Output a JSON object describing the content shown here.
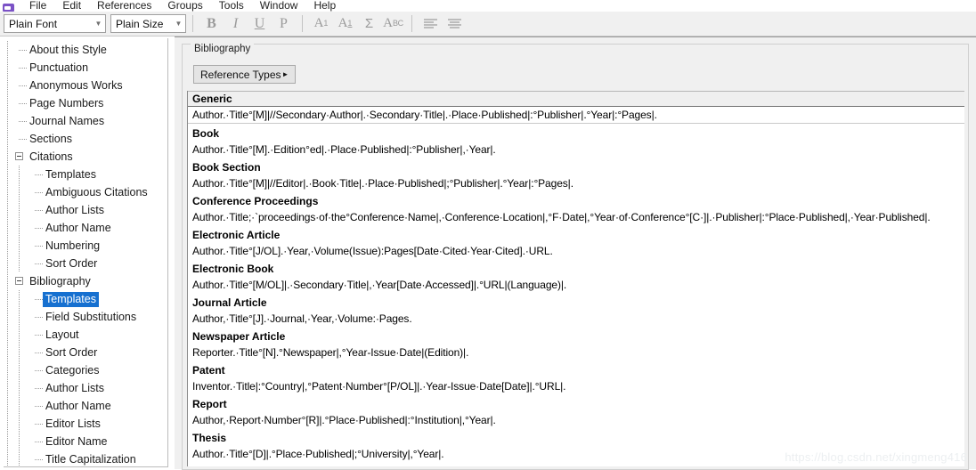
{
  "app": {
    "logo_icon": "endnote-logo-icon",
    "menu": [
      "File",
      "Edit",
      "References",
      "Groups",
      "Tools",
      "Window",
      "Help"
    ]
  },
  "toolbar": {
    "font_combo": {
      "value": "Plain Font",
      "arrow_icon": "chevron-down-icon"
    },
    "size_combo": {
      "value": "Plain Size",
      "arrow_icon": "chevron-down-icon"
    },
    "buttons": [
      {
        "name": "bold-button",
        "label": "B",
        "icon": "bold-icon"
      },
      {
        "name": "italic-button",
        "label": "I",
        "icon": "italic-icon"
      },
      {
        "name": "underline-button",
        "label": "U",
        "icon": "underline-icon"
      },
      {
        "name": "plain-button",
        "label": "P",
        "icon": "plain-text-icon"
      },
      {
        "name": "superscript-button",
        "label": "A1",
        "icon": "superscript-icon"
      },
      {
        "name": "subscript-button",
        "label": "A1",
        "icon": "subscript-icon"
      },
      {
        "name": "symbol-button",
        "label": "Σ",
        "icon": "sigma-symbol-icon"
      },
      {
        "name": "abc-button",
        "label": "ABC",
        "icon": "spellcheck-abc-icon"
      },
      {
        "name": "align-left-button",
        "label": "",
        "icon": "align-left-icon"
      },
      {
        "name": "align-justify-button",
        "label": "",
        "icon": "align-justify-icon"
      }
    ]
  },
  "tree": {
    "items": [
      {
        "label": "About this Style",
        "level": 1,
        "expander": false,
        "selected": false
      },
      {
        "label": "Punctuation",
        "level": 1,
        "expander": false,
        "selected": false
      },
      {
        "label": "Anonymous Works",
        "level": 1,
        "expander": false,
        "selected": false
      },
      {
        "label": "Page Numbers",
        "level": 1,
        "expander": false,
        "selected": false
      },
      {
        "label": "Journal Names",
        "level": 1,
        "expander": false,
        "selected": false
      },
      {
        "label": "Sections",
        "level": 1,
        "expander": false,
        "selected": false
      },
      {
        "label": "Citations",
        "level": 1,
        "expander": true,
        "selected": false
      },
      {
        "label": "Templates",
        "level": 2,
        "expander": false,
        "selected": false
      },
      {
        "label": "Ambiguous Citations",
        "level": 2,
        "expander": false,
        "selected": false
      },
      {
        "label": "Author Lists",
        "level": 2,
        "expander": false,
        "selected": false
      },
      {
        "label": "Author Name",
        "level": 2,
        "expander": false,
        "selected": false
      },
      {
        "label": "Numbering",
        "level": 2,
        "expander": false,
        "selected": false
      },
      {
        "label": "Sort Order",
        "level": 2,
        "expander": false,
        "selected": false
      },
      {
        "label": "Bibliography",
        "level": 1,
        "expander": true,
        "selected": false
      },
      {
        "label": "Templates",
        "level": 2,
        "expander": false,
        "selected": true
      },
      {
        "label": "Field Substitutions",
        "level": 2,
        "expander": false,
        "selected": false
      },
      {
        "label": "Layout",
        "level": 2,
        "expander": false,
        "selected": false
      },
      {
        "label": "Sort Order",
        "level": 2,
        "expander": false,
        "selected": false
      },
      {
        "label": "Categories",
        "level": 2,
        "expander": false,
        "selected": false
      },
      {
        "label": "Author Lists",
        "level": 2,
        "expander": false,
        "selected": false
      },
      {
        "label": "Author Name",
        "level": 2,
        "expander": false,
        "selected": false
      },
      {
        "label": "Editor Lists",
        "level": 2,
        "expander": false,
        "selected": false
      },
      {
        "label": "Editor Name",
        "level": 2,
        "expander": false,
        "selected": false
      },
      {
        "label": "Title Capitalization",
        "level": 2,
        "expander": false,
        "selected": false
      }
    ]
  },
  "panel": {
    "legend": "Bibliography",
    "reference_types_button": "Reference Types",
    "reference_types_caret_icon": "caret-right-icon"
  },
  "templates": [
    {
      "type": "Generic",
      "template": "Author.·Title°[M]|//Secondary·Author|.·Secondary·Title|.·Place·Published|:°Publisher|.°Year|:°Pages|."
    },
    {
      "type": "Book",
      "template": "Author.·Title°[M].·Edition°ed|.·Place·Published|:°Publisher|,·Year|."
    },
    {
      "type": "Book Section",
      "template": "Author.·Title°[M]|//Editor|.·Book·Title|.·Place·Published|;°Publisher|.°Year|:°Pages|."
    },
    {
      "type": "Conference Proceedings",
      "template": "Author.·Title;·`proceedings·of·the°Conference·Name|,·Conference·Location|,°F·Date|,°Year·of·Conference°[C·]|.·Publisher|:°Place·Published|,·Year·Published|."
    },
    {
      "type": "Electronic Article",
      "template": "Author.·Title°[J/OL].·Year,·Volume(Issue):Pages[Date·Cited·Year·Cited].·URL."
    },
    {
      "type": "Electronic Book",
      "template": "Author.·Title°[M/OL]|.·Secondary·Title|,·Year[Date·Accessed]|.°URL|(Language)|."
    },
    {
      "type": "Journal Article",
      "template": "Author,·Title°[J].·Journal,·Year,·Volume:·Pages."
    },
    {
      "type": "Newspaper Article",
      "template": "Reporter.·Title°[N].°Newspaper|,°Year-Issue·Date|(Edition)|."
    },
    {
      "type": "Patent",
      "template": "Inventor.·Title|:°Country|,°Patent·Number°[P/OL]|.·Year-Issue·Date[Date]|.°URL|."
    },
    {
      "type": "Report",
      "template": "Author,·Report·Number°[R]|.°Place·Published|:°Institution|,°Year|."
    },
    {
      "type": "Thesis",
      "template": "Author.·Title°[D]|.°Place·Published|;°University|,°Year|."
    }
  ],
  "watermark": "https://blog.csdn.net/xingmeng416",
  "colors": {
    "selection": "#1670d0",
    "toolbar_bg": "#f0f0f0",
    "panel_bg": "#f0f0f0",
    "header_row_bg": "#efefef"
  }
}
